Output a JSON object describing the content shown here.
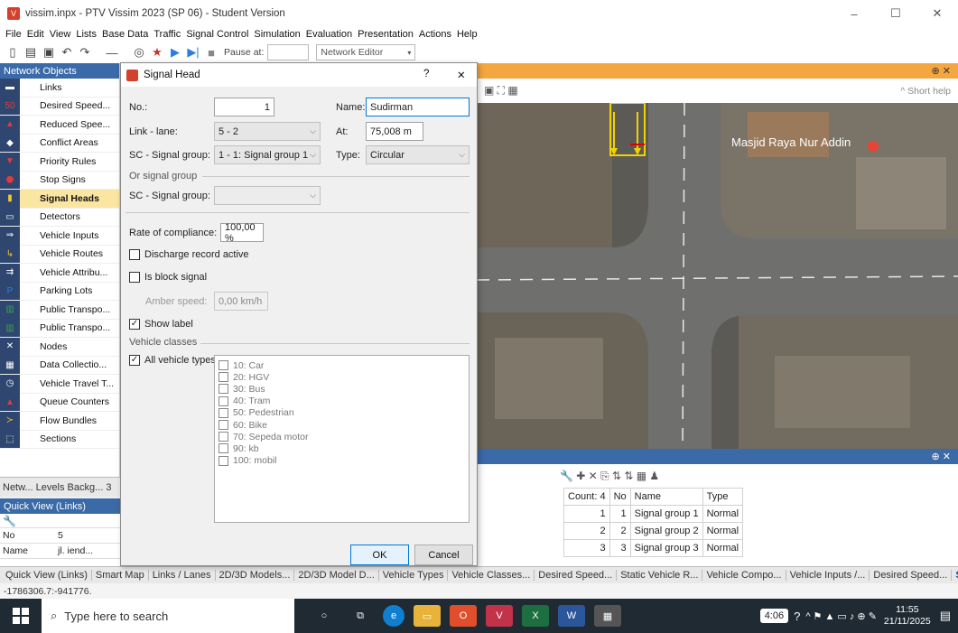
{
  "window": {
    "title": "vissim.inpx - PTV Vissim 2023 (SP 06) - Student Version",
    "minimize": "–",
    "maximize": "☐",
    "close": "✕"
  },
  "menu": [
    "File",
    "Edit",
    "View",
    "Lists",
    "Base Data",
    "Traffic",
    "Signal Control",
    "Simulation",
    "Evaluation",
    "Presentation",
    "Actions",
    "Help"
  ],
  "toolbar": {
    "pause_label": "Pause at:",
    "pause_value": "",
    "editor_select": "Network Editor"
  },
  "network_objects": {
    "title": "Network Objects",
    "items": [
      {
        "label": "Links",
        "icon": "links-icon"
      },
      {
        "label": "Desired Speed...",
        "icon": "speed-sign-icon"
      },
      {
        "label": "Reduced Spee...",
        "icon": "warning-icon"
      },
      {
        "label": "Conflict Areas",
        "icon": "conflict-icon"
      },
      {
        "label": "Priority Rules",
        "icon": "priority-icon"
      },
      {
        "label": "Stop Signs",
        "icon": "stop-sign-icon"
      },
      {
        "label": "Signal Heads",
        "icon": "signal-head-icon"
      },
      {
        "label": "Detectors",
        "icon": "detector-icon"
      },
      {
        "label": "Vehicle Inputs",
        "icon": "vehicle-input-icon"
      },
      {
        "label": "Vehicle Routes",
        "icon": "route-icon"
      },
      {
        "label": "Vehicle Attribu...",
        "icon": "vehicle-attr-icon"
      },
      {
        "label": "Parking Lots",
        "icon": "parking-icon"
      },
      {
        "label": "Public Transpo...",
        "icon": "pt-stop-icon"
      },
      {
        "label": "Public Transpo...",
        "icon": "pt-line-icon"
      },
      {
        "label": "Nodes",
        "icon": "nodes-icon"
      },
      {
        "label": "Data Collectio...",
        "icon": "data-collection-icon"
      },
      {
        "label": "Vehicle Travel T...",
        "icon": "travel-time-icon"
      },
      {
        "label": "Queue Counters",
        "icon": "queue-icon"
      },
      {
        "label": "Flow Bundles",
        "icon": "flow-icon"
      },
      {
        "label": "Sections",
        "icon": "sections-icon"
      }
    ],
    "selected_index": 6
  },
  "left_tabs": "Netw...  Levels  Backg...  3",
  "quick_view": {
    "title": "Quick View (Links)",
    "rows": [
      {
        "key": "No",
        "value": "5"
      },
      {
        "key": "Name",
        "value": "jl. iend..."
      }
    ]
  },
  "map": {
    "short_help": "^ Short help",
    "place_label": "Masjid Raya Nur Addin"
  },
  "dialog": {
    "title": "Signal Head",
    "help": "?",
    "close": "✕",
    "no_label": "No.:",
    "no_value": "1",
    "name_label": "Name:",
    "name_value": "Sudirman",
    "link_lane_label": "Link - lane:",
    "link_lane_value": "5 - 2",
    "at_label": "At:",
    "at_value": "75,008 m",
    "sc_group_label": "SC - Signal group:",
    "sc_group_value": "1 - 1: Signal group 1",
    "type_label": "Type:",
    "type_value": "Circular",
    "or_signal_group": "Or signal group",
    "sc_group2_label": "SC - Signal group:",
    "sc_group2_value": "",
    "compliance_label": "Rate of compliance:",
    "compliance_value": "100,00 %",
    "discharge_label": "Discharge record active",
    "discharge_checked": false,
    "block_label": "Is block signal",
    "block_checked": false,
    "amber_label": "Amber speed:",
    "amber_value": "0,00 km/h",
    "show_label": "Show label",
    "show_label_checked": true,
    "vehicle_classes_title": "Vehicle classes",
    "all_vehicle_types": "All vehicle types",
    "all_vehicle_types_checked": true,
    "vehicle_classes": [
      "10: Car",
      "20: HGV",
      "30: Bus",
      "40: Tram",
      "50: Pedestrian",
      "60: Bike",
      "70: Sepeda motor",
      "90: kb",
      "100: mobil"
    ],
    "ok": "OK",
    "cancel": "Cancel"
  },
  "signal_groups": {
    "headers": [
      "Count: 4",
      "No",
      "Name",
      "Type"
    ],
    "rows": [
      [
        "1",
        "1",
        "Signal group 1",
        "Normal"
      ],
      [
        "2",
        "2",
        "Signal group 2",
        "Normal"
      ],
      [
        "3",
        "3",
        "Signal group 3",
        "Normal"
      ]
    ]
  },
  "bottom_tabs": [
    "Quick View (Links)",
    "Smart Map",
    "Links / Lanes",
    "2D/3D Models...",
    "2D/3D Model D...",
    "Vehicle Types",
    "Vehicle Classes...",
    "Desired Speed...",
    "Static Vehicle R...",
    "Vehicle Compo...",
    "Vehicle Inputs /...",
    "Desired Speed...",
    "Signal Controll..."
  ],
  "status_text": "-1786306.7:-941776.",
  "taskbar": {
    "search_placeholder": "Type here to search",
    "clock_time": "11:55",
    "clock_date": "21/11/2025",
    "timer": "4:06"
  }
}
